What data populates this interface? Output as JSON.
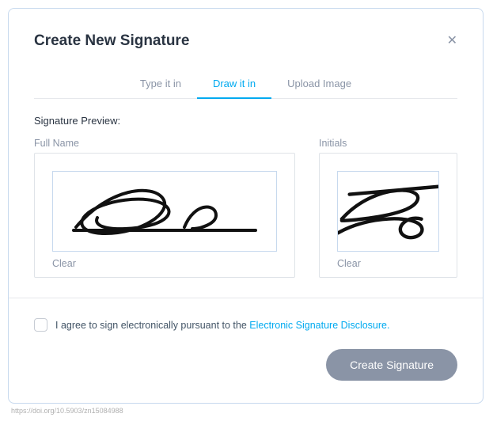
{
  "modal": {
    "title": "Create New Signature",
    "close_icon": "✕"
  },
  "tabs": {
    "type": "Type it in",
    "draw": "Draw it in",
    "upload": "Upload Image"
  },
  "preview": {
    "label": "Signature Preview:",
    "full_name_label": "Full Name",
    "initials_label": "Initials",
    "clear": "Clear"
  },
  "footer": {
    "agree_pre": "I agree to sign electronically pursuant to the ",
    "agree_link": "Electronic Signature Disclosure.",
    "create_button": "Create Signature"
  },
  "tiny": "https://doi.org/10.5903/zn15084988"
}
